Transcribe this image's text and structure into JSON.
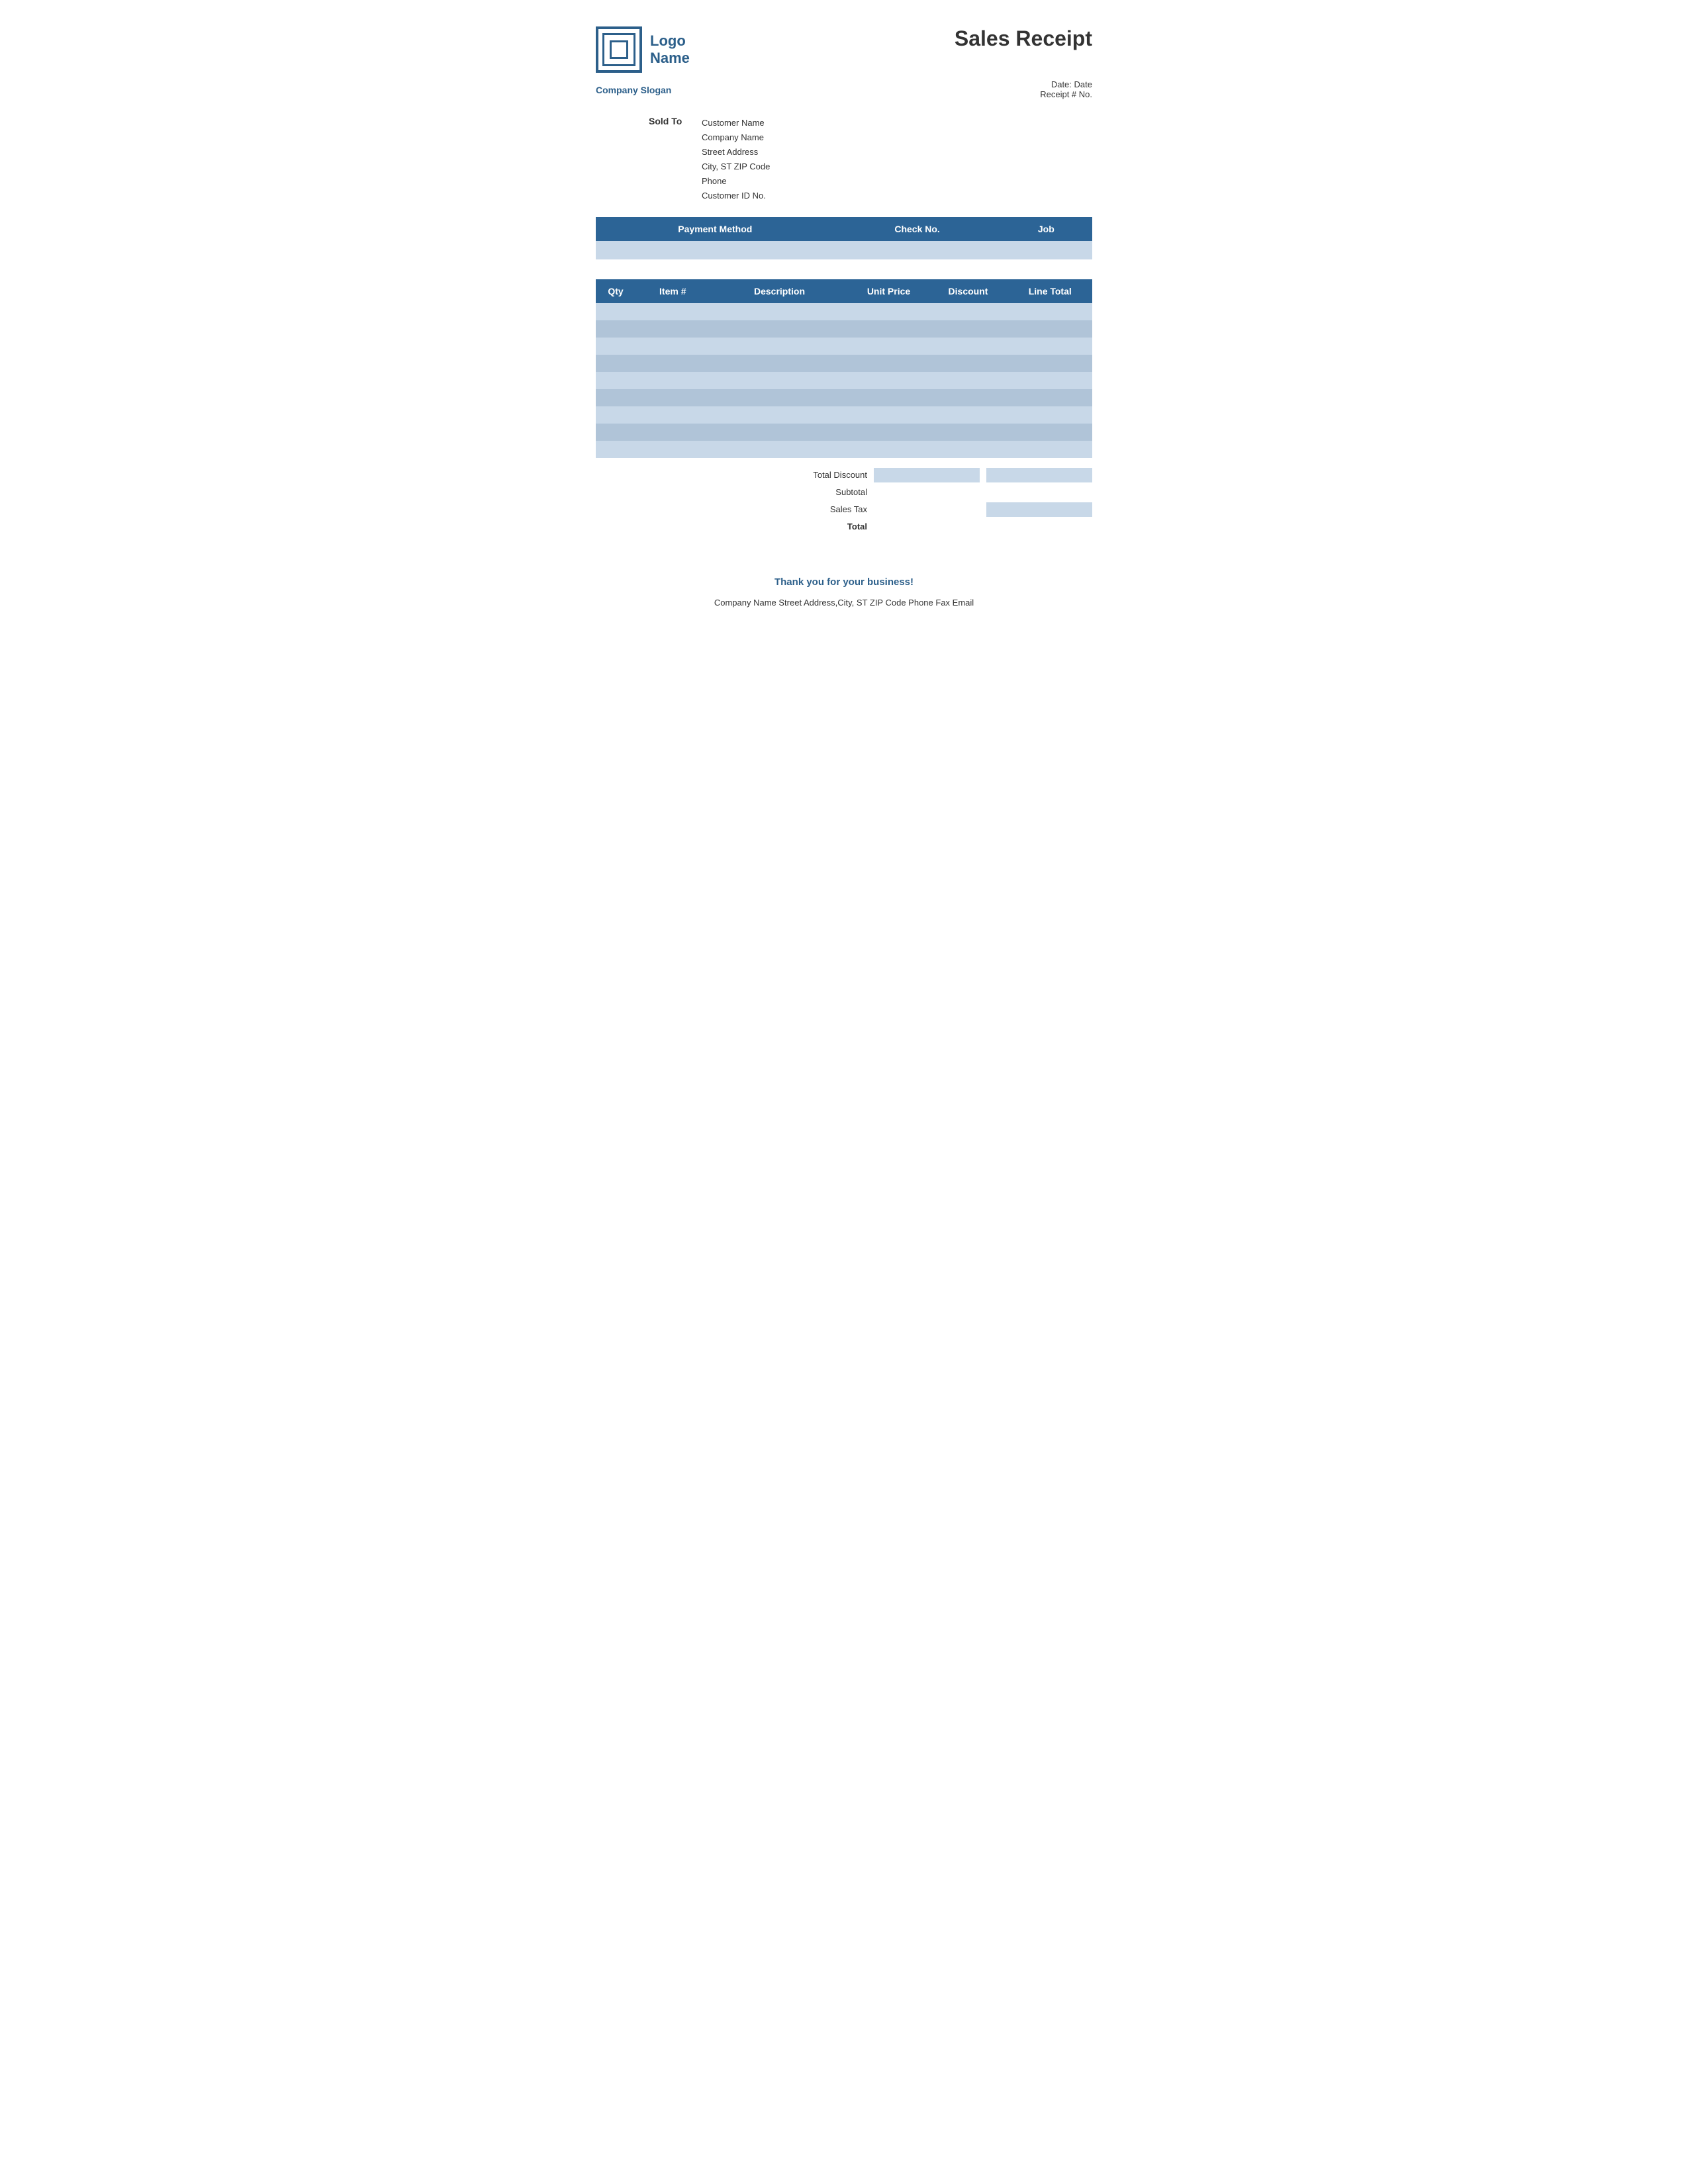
{
  "company": {
    "logo_text": "Logo\nName",
    "logo_line1": "Logo",
    "logo_line2": "Name",
    "slogan": "Company Slogan"
  },
  "title": "Sales Receipt",
  "date_label": "Date:",
  "date_value": "Date",
  "receipt_label": "Receipt # No.",
  "sold_to": {
    "label": "Sold To",
    "customer_name": "Customer Name",
    "company_name": "Company Name",
    "street": "Street Address",
    "city": "City, ST  ZIP Code",
    "phone": "Phone",
    "customer_id": "Customer ID No."
  },
  "payment_headers": [
    "Payment Method",
    "Check No.",
    "Job"
  ],
  "items_headers": [
    "Qty",
    "Item #",
    "Description",
    "Unit Price",
    "Discount",
    "Line Total"
  ],
  "totals": {
    "total_discount_label": "Total Discount",
    "subtotal_label": "Subtotal",
    "sales_tax_label": "Sales Tax",
    "total_label": "Total"
  },
  "footer": {
    "thank_you": "Thank you for your business!",
    "address": "Company Name   Street Address,City, ST  ZIP Code   Phone   Fax   Email"
  }
}
